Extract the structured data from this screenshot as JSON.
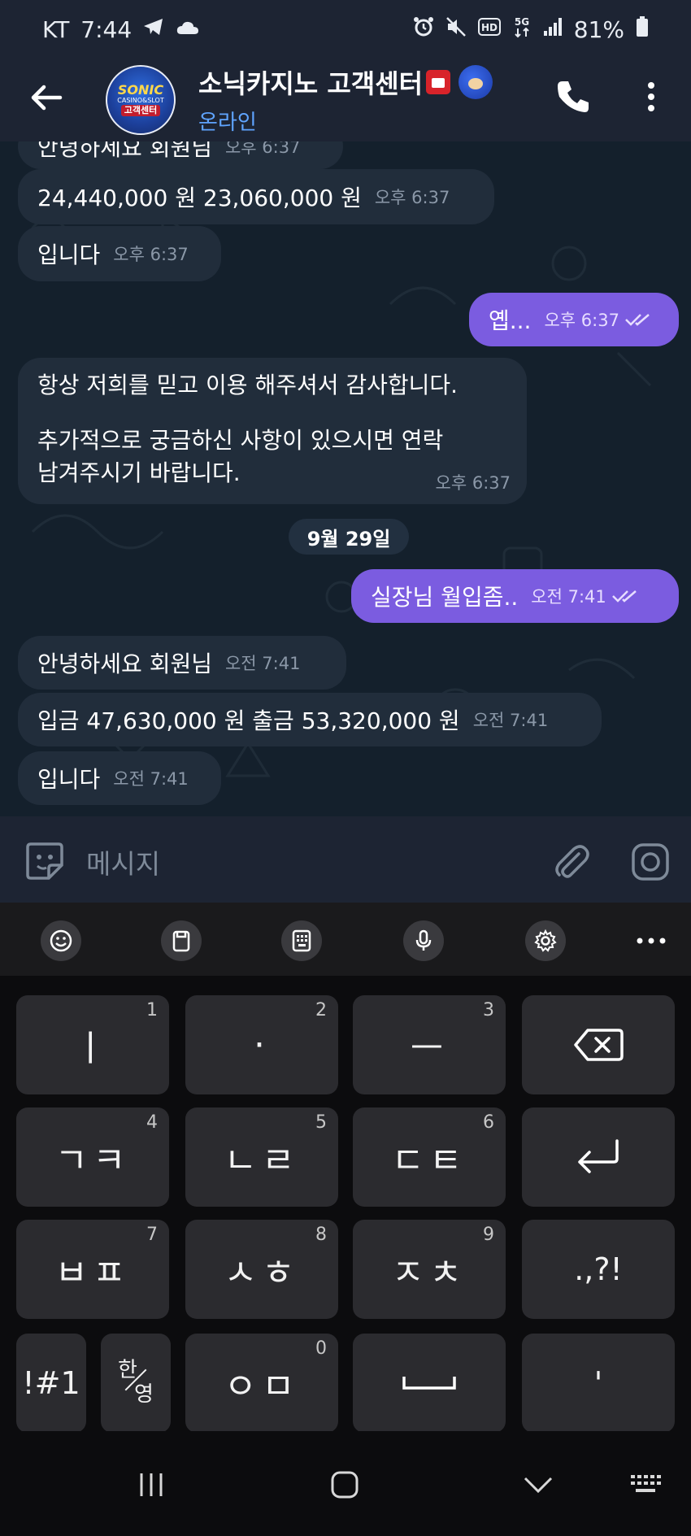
{
  "status_bar": {
    "carrier": "KT",
    "time": "7:44",
    "battery": "81%",
    "icons": [
      "telegram-icon",
      "cloud-icon",
      "alarm-icon",
      "mute-icon",
      "hd-icon",
      "5g-icon",
      "signal-icon",
      "battery-icon"
    ]
  },
  "header": {
    "title": "소닉카지노 고객센터",
    "status": "온라인",
    "avatar": {
      "line1": "SONIC",
      "line2": "CASINO&SLOT",
      "line3": "고객센터"
    },
    "accent_color": "#5fa4ff"
  },
  "chat": {
    "messages": [
      {
        "dir": "in",
        "text": "안녕하세요 회원님",
        "time": "오후 6:37",
        "partial": true
      },
      {
        "dir": "in",
        "text": "24,440,000 원   23,060,000 원",
        "time": "오후 6:37"
      },
      {
        "dir": "in",
        "text": "입니다",
        "time": "오후 6:37"
      },
      {
        "dir": "out",
        "text": "옙...",
        "time": "오후 6:37",
        "read": true
      },
      {
        "dir": "in",
        "lines": [
          "항상 저희를 믿고 이용 해주셔서 감사합니다.",
          "",
          "추가적으로 궁금하신 사항이 있으시면 연락",
          "남겨주시기 바랍니다."
        ],
        "time": "오후 6:37"
      },
      {
        "dir": "date",
        "text": "9월 29일"
      },
      {
        "dir": "out",
        "text": "실장님 월입좀..",
        "time": "오전 7:41",
        "read": true
      },
      {
        "dir": "in",
        "text": "안녕하세요 회원님",
        "time": "오전 7:41"
      },
      {
        "dir": "in",
        "text": "입금 47,630,000 원   출금 53,320,000 원",
        "time": "오전 7:41"
      },
      {
        "dir": "in",
        "text": "입니다",
        "time": "오전 7:41"
      }
    ],
    "outgoing_color": "#7b5ce0",
    "incoming_color": "#212d3b"
  },
  "input": {
    "placeholder": "메시지"
  },
  "keyboard": {
    "toolbar": [
      "emoji-icon",
      "clipboard-icon",
      "keypad-icon",
      "mic-icon",
      "settings-icon",
      "more-icon"
    ],
    "rows": [
      [
        {
          "label": "ㅣ",
          "num": "1"
        },
        {
          "label": "·",
          "num": "2"
        },
        {
          "label": "ㅡ",
          "num": "3"
        },
        {
          "label": "backspace"
        }
      ],
      [
        {
          "label": "ㄱㅋ",
          "num": "4"
        },
        {
          "label": "ㄴㄹ",
          "num": "5"
        },
        {
          "label": "ㄷㅌ",
          "num": "6"
        },
        {
          "label": "enter"
        }
      ],
      [
        {
          "label": "ㅂㅍ",
          "num": "7"
        },
        {
          "label": "ㅅㅎ",
          "num": "8"
        },
        {
          "label": "ㅈㅊ",
          "num": "9"
        },
        {
          "label": ".,?!"
        }
      ],
      [
        {
          "label": "!#1"
        },
        {
          "label": "한/영",
          "top": "한",
          "bottom": "영"
        },
        {
          "label": "ㅇㅁ",
          "num": "0"
        },
        {
          "label": "space"
        },
        {
          "label": "'"
        }
      ]
    ]
  },
  "nav_bar": [
    "recents-icon",
    "home-icon",
    "hide-keyboard-icon",
    "keyboard-switch-icon"
  ]
}
